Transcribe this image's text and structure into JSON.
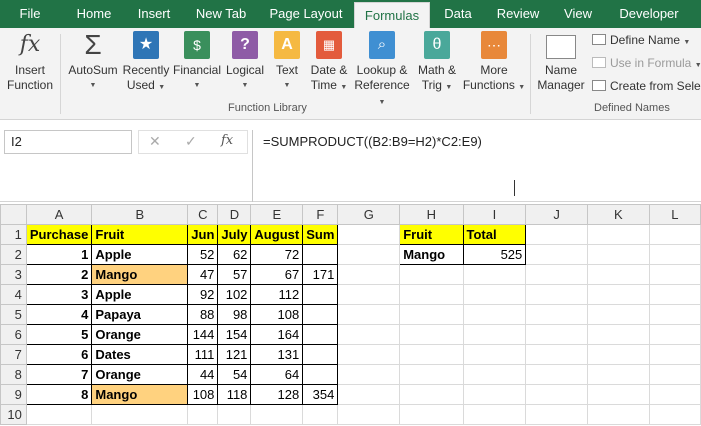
{
  "tabs": [
    "File",
    "Home",
    "Insert",
    "New Tab",
    "Page Layout",
    "Formulas",
    "Data",
    "Review",
    "View",
    "Developer"
  ],
  "ribbon": {
    "insert_function": [
      "Insert",
      "Function"
    ],
    "autosum": "AutoSum",
    "recently_used": [
      "Recently",
      "Used"
    ],
    "financial": "Financial",
    "logical": "Logical",
    "text": "Text",
    "date_time": [
      "Date &",
      "Time"
    ],
    "lookup": [
      "Lookup &",
      "Reference"
    ],
    "math": [
      "Math &",
      "Trig"
    ],
    "more": [
      "More",
      "Functions"
    ],
    "function_library_label": "Function Library",
    "name_manager": [
      "Name",
      "Manager"
    ],
    "define_name": "Define Name",
    "use_in_formula": "Use in Formula",
    "create_from_selection": "Create from Selection",
    "defined_names_label": "Defined Names",
    "icon_text": {
      "fx": "fx",
      "sigma": "Σ",
      "theta": "θ",
      "text_a": "A"
    }
  },
  "formula_bar": {
    "name_box": "I2",
    "cancel": "✕",
    "enter": "✓",
    "fx": "fx",
    "formula": "=SUMPRODUCT((B2:B9=H2)*C2:E9)"
  },
  "columns": [
    "A",
    "B",
    "C",
    "D",
    "E",
    "F",
    "G",
    "H",
    "I",
    "J",
    "K",
    "L"
  ],
  "rows": [
    {
      "n": "1",
      "cells": [
        "Purchase",
        "Fruit",
        "Jun",
        "July",
        "August",
        "Sum",
        "",
        "Fruit",
        "Total",
        "",
        "",
        ""
      ]
    },
    {
      "n": "2",
      "cells": [
        "1",
        "Apple",
        "52",
        "62",
        "72",
        "",
        "",
        "Mango",
        "525",
        "",
        "",
        ""
      ]
    },
    {
      "n": "3",
      "cells": [
        "2",
        "Mango",
        "47",
        "57",
        "67",
        "171",
        "",
        "",
        "",
        "",
        "",
        ""
      ]
    },
    {
      "n": "4",
      "cells": [
        "3",
        "Apple",
        "92",
        "102",
        "112",
        "",
        "",
        "",
        "",
        "",
        "",
        ""
      ]
    },
    {
      "n": "5",
      "cells": [
        "4",
        "Papaya",
        "88",
        "98",
        "108",
        "",
        "",
        "",
        "",
        "",
        "",
        ""
      ]
    },
    {
      "n": "6",
      "cells": [
        "5",
        "Orange",
        "144",
        "154",
        "164",
        "",
        "",
        "",
        "",
        "",
        "",
        ""
      ]
    },
    {
      "n": "7",
      "cells": [
        "6",
        "Dates",
        "111",
        "121",
        "131",
        "",
        "",
        "",
        "",
        "",
        "",
        ""
      ]
    },
    {
      "n": "8",
      "cells": [
        "7",
        "Orange",
        "44",
        "54",
        "64",
        "",
        "",
        "",
        "",
        "",
        "",
        ""
      ]
    },
    {
      "n": "9",
      "cells": [
        "8",
        "Mango",
        "108",
        "118",
        "128",
        "354",
        "",
        "",
        "",
        "",
        "",
        ""
      ]
    },
    {
      "n": "10",
      "cells": [
        "",
        "",
        "",
        "",
        "",
        "",
        "",
        "",
        "",
        "",
        "",
        ""
      ]
    }
  ],
  "colors": {
    "accent": "#217346",
    "header_fill": "#ffff00",
    "highlight": "#ffd27f"
  }
}
